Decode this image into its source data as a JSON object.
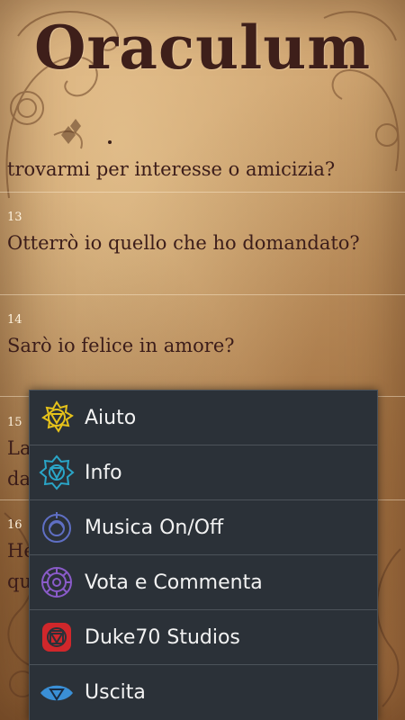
{
  "app": {
    "title": "Oraculum"
  },
  "questions": {
    "partial_top": "trovarmi per interesse o amicizia?",
    "items": [
      {
        "number": "13",
        "text": "Otterrò io quello che ho domandato?"
      },
      {
        "number": "14",
        "text": "Sarò io felice in amore?"
      },
      {
        "number": "15",
        "text_line1": "La",
        "text_line2": "da"
      },
      {
        "number": "16",
        "text_line1": "He",
        "text_line2": "qu"
      }
    ]
  },
  "menu": {
    "items": [
      {
        "label": "Aiuto",
        "icon": "solar-plexus-chakra-icon",
        "color": "#e6c21a"
      },
      {
        "label": "Info",
        "icon": "throat-chakra-icon",
        "color": "#2aa6c8"
      },
      {
        "label": "Musica On/Off",
        "icon": "third-eye-chakra-icon",
        "color": "#5f6fc4"
      },
      {
        "label": "Vota e Commenta",
        "icon": "crown-chakra-icon",
        "color": "#8a5bc9"
      },
      {
        "label": "Duke70 Studios",
        "icon": "root-chakra-icon",
        "color": "#d0272b"
      },
      {
        "label": "Uscita",
        "icon": "eye-icon",
        "color": "#3a8fd6"
      }
    ]
  }
}
